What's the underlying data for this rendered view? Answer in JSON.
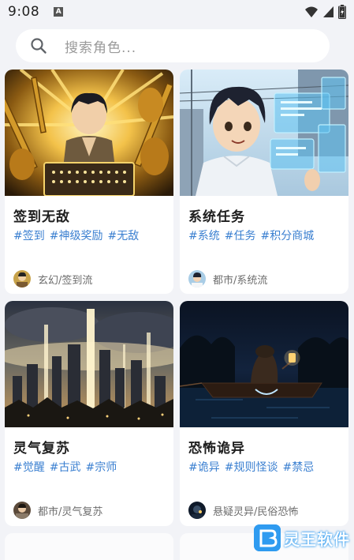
{
  "status_bar": {
    "time": "9:08",
    "badge": "A"
  },
  "search": {
    "placeholder": "搜索角色..."
  },
  "cards": [
    {
      "title": "签到无敌",
      "tags": [
        "#签到",
        "#神级奖励",
        "#无敌"
      ],
      "category": "玄幻/签到流"
    },
    {
      "title": "系统任务",
      "tags": [
        "#系统",
        "#任务",
        "#积分商城"
      ],
      "category": "都市/系统流"
    },
    {
      "title": "灵气复苏",
      "tags": [
        "#觉醒",
        "#古武",
        "#宗师"
      ],
      "category": "都市/灵气复苏"
    },
    {
      "title": "恐怖诡异",
      "tags": [
        "#诡异",
        "#规则怪谈",
        "#禁忌"
      ],
      "category": "悬疑灵异/民俗恐怖"
    }
  ],
  "watermark": {
    "text": "灵王软件"
  },
  "icons": {
    "status": [
      "wifi-icon",
      "signal-icon",
      "battery-icon"
    ],
    "search": "search-icon"
  }
}
